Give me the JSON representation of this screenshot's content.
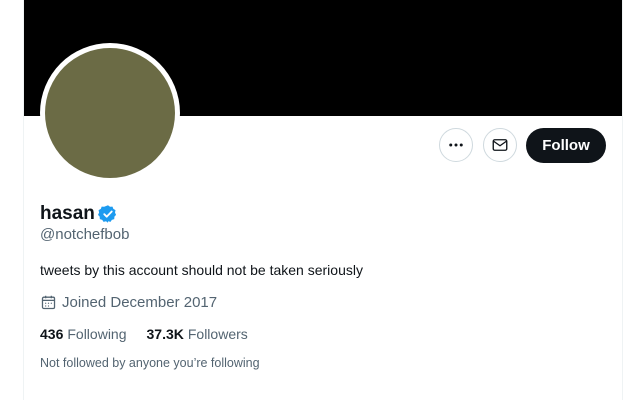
{
  "profile": {
    "display_name": "hasan",
    "handle": "@notchefbob",
    "verified": true,
    "bio": "tweets by this account should not be taken seriously",
    "joined": "Joined December 2017",
    "avatar_color": "#6b6b45",
    "banner_color": "#000000"
  },
  "actions": {
    "more_icon": "more-horizontal-icon",
    "message_icon": "envelope-icon",
    "follow_label": "Follow"
  },
  "stats": {
    "following_count": "436",
    "following_label": "Following",
    "followers_count": "37.3K",
    "followers_label": "Followers"
  },
  "followed_by_text": "Not followed by anyone you’re following",
  "colors": {
    "verified_blue": "#1d9bf0",
    "secondary_text": "#536471",
    "primary_text": "#0f1419"
  }
}
